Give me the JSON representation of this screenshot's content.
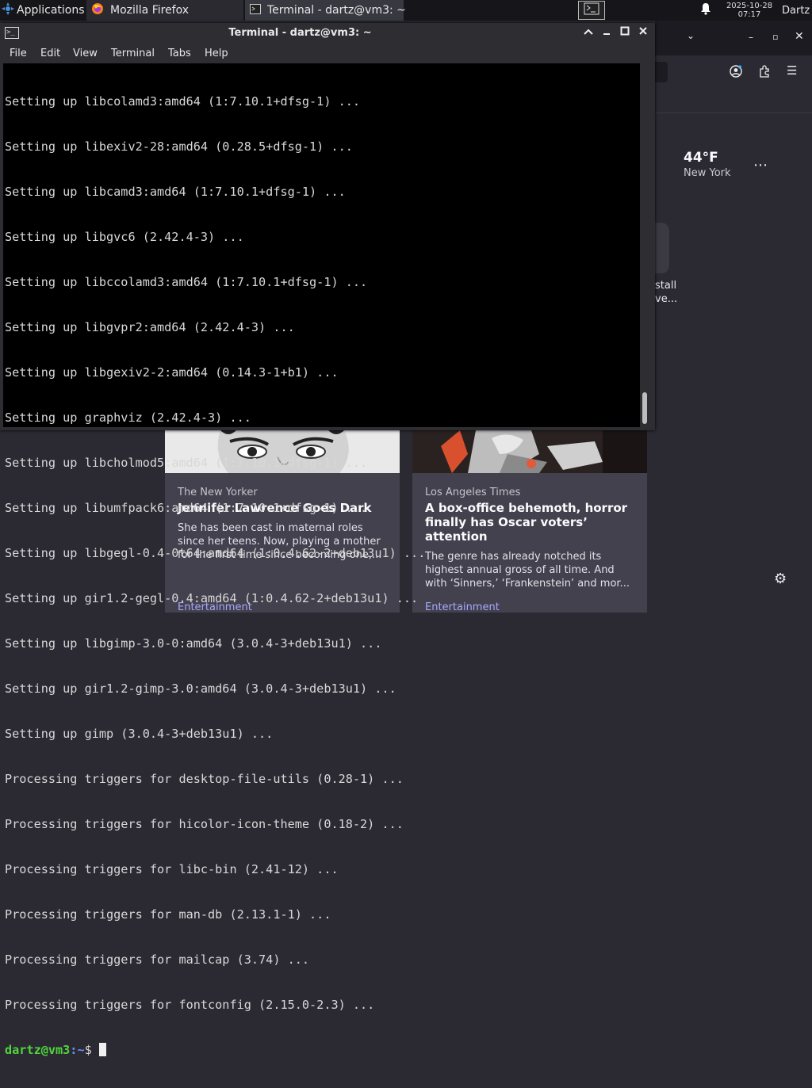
{
  "taskbar": {
    "applications_label": "Applications",
    "firefox_label": "Mozilla Firefox",
    "terminal_label": "Terminal - dartz@vm3: ~",
    "clock_date": "2025-10-28",
    "clock_time": "07:17",
    "user": "Dartz",
    "icons": [
      "xfce-menu-icon",
      "firefox-icon",
      "terminal-icon",
      "workspace-icon",
      "bell-icon"
    ]
  },
  "terminal": {
    "title": "Terminal - dartz@vm3: ~",
    "menu": [
      "File",
      "Edit",
      "View",
      "Terminal",
      "Tabs",
      "Help"
    ],
    "lines": [
      "Setting up libcolamd3:amd64 (1:7.10.1+dfsg-1) ...",
      "Setting up libexiv2-28:amd64 (0.28.5+dfsg-1) ...",
      "Setting up libcamd3:amd64 (1:7.10.1+dfsg-1) ...",
      "Setting up libgvc6 (2.42.4-3) ...",
      "Setting up libccolamd3:amd64 (1:7.10.1+dfsg-1) ...",
      "Setting up libgvpr2:amd64 (2.42.4-3) ...",
      "Setting up libgexiv2-2:amd64 (0.14.3-1+b1) ...",
      "Setting up graphviz (2.42.4-3) ...",
      "Setting up libcholmod5:amd64 (1:7.10.1+dfsg-1) ...",
      "Setting up libumfpack6:amd64 (1:7.10.1+dfsg-1) ...",
      "Setting up libgegl-0.4-0t64:amd64 (1:0.4.62-2+deb13u1) ...",
      "Setting up gir1.2-gegl-0.4:amd64 (1:0.4.62-2+deb13u1) ...",
      "Setting up libgimp-3.0-0:amd64 (3.0.4-3+deb13u1) ...",
      "Setting up gir1.2-gimp-3.0:amd64 (3.0.4-3+deb13u1) ...",
      "Setting up gimp (3.0.4-3+deb13u1) ...",
      "Processing triggers for desktop-file-utils (0.28-1) ...",
      "Processing triggers for hicolor-icon-theme (0.18-2) ...",
      "Processing triggers for libc-bin (2.41-12) ...",
      "Processing triggers for man-db (2.13.1-1) ...",
      "Processing triggers for mailcap (3.74) ...",
      "Processing triggers for fontconfig (2.15.0-2.3) ..."
    ],
    "prompt": {
      "user_host": "dartz@vm3",
      "sep": ":",
      "path": "~",
      "symbol": "$ "
    }
  },
  "firefox": {
    "weather": {
      "temp": "44°F",
      "city": "New York"
    },
    "install_text": [
      "stall",
      "ve..."
    ],
    "cards": [
      {
        "source": "The New Yorker",
        "title": "Jennifer Lawrence Goes Dark",
        "description": "She has been cast in maternal roles since her teens. Now, playing a mother for the first time since becoming one,...",
        "category": "Entertainment"
      },
      {
        "source": "Los Angeles Times",
        "title": "A box-office behemoth, horror finally has Oscar voters’ attention",
        "description": "The genre has already notched its highest annual gross of all time. And with ‘Sinners,’ ‘Frankenstein’ and mor...",
        "category": "Entertainment"
      }
    ]
  }
}
